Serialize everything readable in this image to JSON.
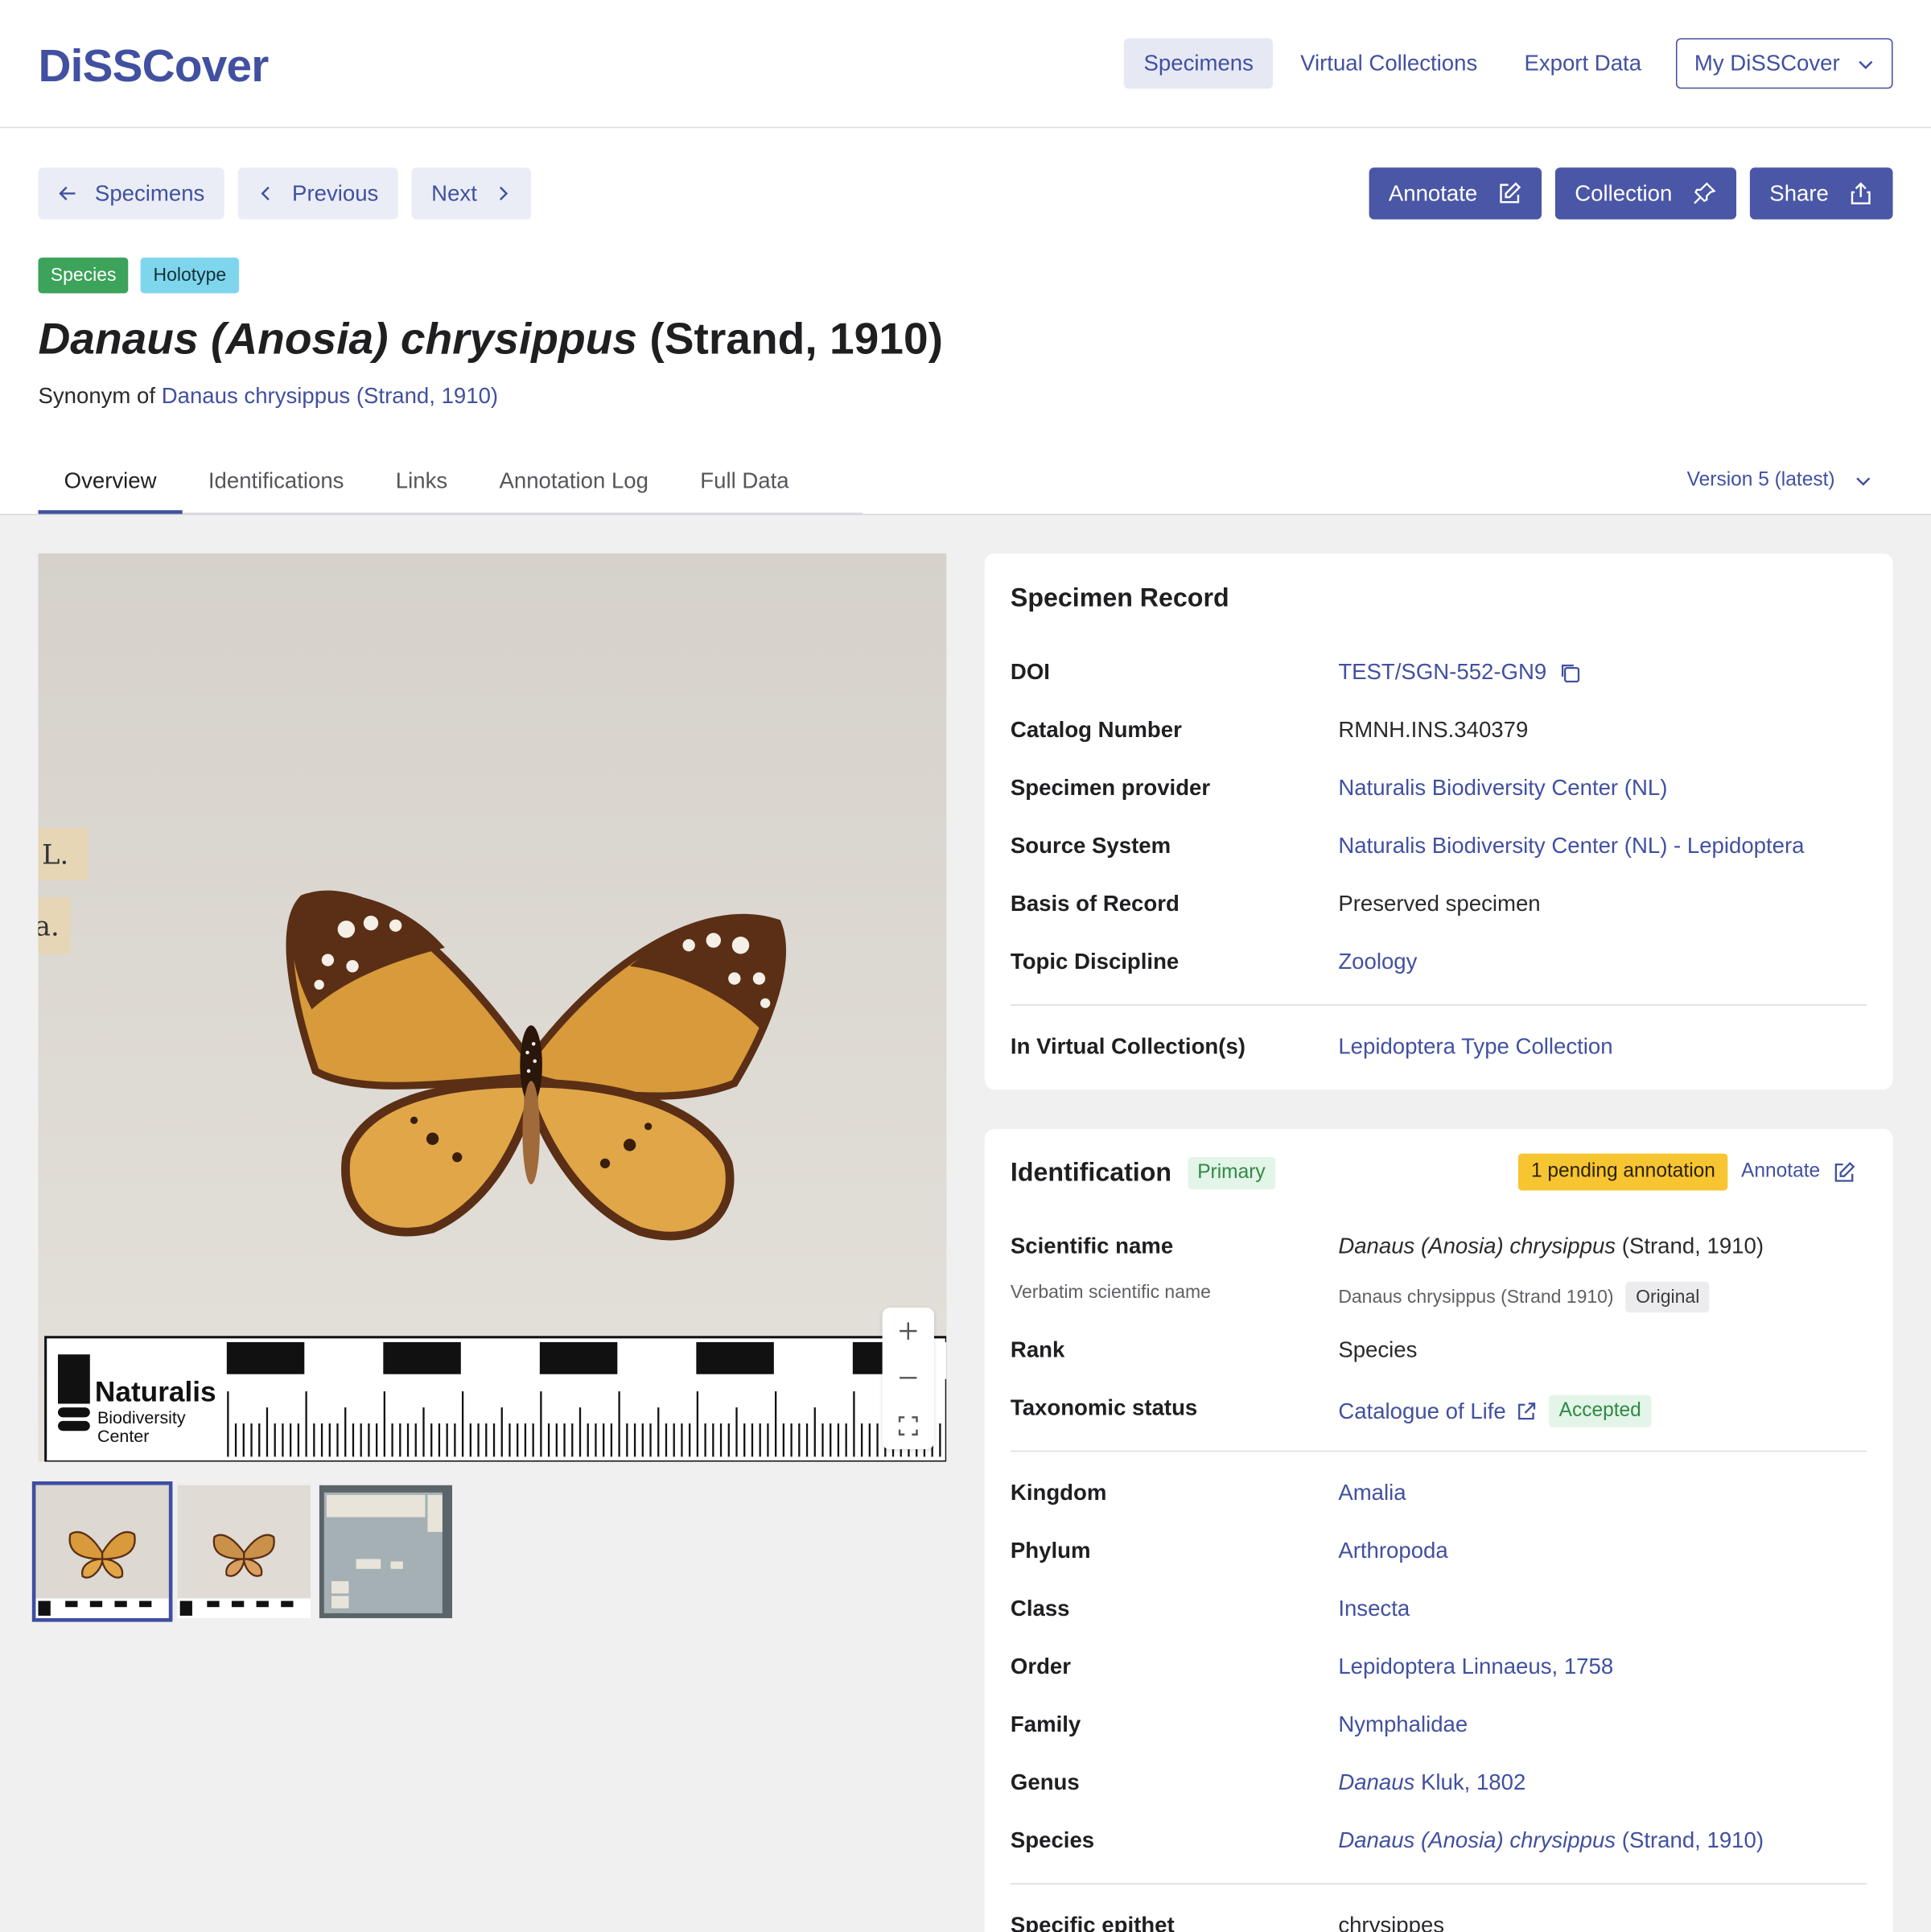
{
  "app": {
    "logo": "DiSSCover"
  },
  "nav": {
    "specimens": "Specimens",
    "virtual_collections": "Virtual Collections",
    "export_data": "Export Data",
    "my": "My DiSSCover"
  },
  "toolbar": {
    "back": "Specimens",
    "previous": "Previous",
    "next": "Next",
    "annotate": "Annotate",
    "collection": "Collection",
    "share": "Share"
  },
  "badges": {
    "species": "Species",
    "holotype": "Holotype"
  },
  "title": {
    "italic": "Danaus (Anosia) chrysippus",
    "author": "(Strand, 1910)"
  },
  "synonym": {
    "label": "Synonym of",
    "value": "Danaus chrysippus (Strand, 1910)"
  },
  "tabs": [
    "Overview",
    "Identifications",
    "Links",
    "Annotation Log",
    "Full Data"
  ],
  "version": "Version 5 (latest)",
  "image": {
    "scale_brand": "Naturalis",
    "scale_sub1": "Biodiversity",
    "scale_sub2": "Center",
    "label_left_1": "L.",
    "label_left_2": "a."
  },
  "specimen_record": {
    "title": "Specimen Record",
    "doi_label": "DOI",
    "doi": "TEST/SGN-552-GN9",
    "catalog_label": "Catalog Number",
    "catalog": "RMNH.INS.340379",
    "provider_label": "Specimen provider",
    "provider": "Naturalis Biodiversity Center (NL)",
    "source_label": "Source System",
    "source": "Naturalis Biodiversity Center (NL) - Lepidoptera",
    "basis_label": "Basis of Record",
    "basis": "Preserved specimen",
    "topic_label": "Topic Discipline",
    "topic": "Zoology",
    "vc_label": "In Virtual Collection(s)",
    "vc": "Lepidoptera Type Collection"
  },
  "identification": {
    "title": "Identification",
    "primary": "Primary",
    "pending": "1 pending annotation",
    "annotate": "Annotate",
    "sci_label": "Scientific name",
    "sci_italic": "Danaus (Anosia) chrysippus",
    "sci_author": "(Strand, 1910)",
    "verbatim_label": "Verbatim scientific name",
    "verbatim": "Danaus chrysippus (Strand 1910)",
    "verbatim_tag": "Original",
    "rank_label": "Rank",
    "rank": "Species",
    "status_label": "Taxonomic status",
    "status_source": "Catalogue of Life",
    "status_tag": "Accepted",
    "kingdom_label": "Kingdom",
    "kingdom": "Amalia",
    "phylum_label": "Phylum",
    "phylum": "Arthropoda",
    "class_label": "Class",
    "class": "Insecta",
    "order_label": "Order",
    "order": "Lepidoptera Linnaeus, 1758",
    "family_label": "Family",
    "family": "Nymphalidae",
    "genus_label": "Genus",
    "genus_italic": "Danaus",
    "genus_author": "Kluk, 1802",
    "species_label": "Species",
    "species_italic": "Danaus (Anosia) chrysippus",
    "species_author": "(Strand, 1910)",
    "epithet_label": "Specific epithet",
    "epithet": "chrysippes"
  },
  "colors": {
    "accent": "#4150a0",
    "button": "#4a56a6",
    "species_badge": "#3ca35a",
    "holotype_badge": "#7ed6ec",
    "pending": "#f7c531"
  }
}
